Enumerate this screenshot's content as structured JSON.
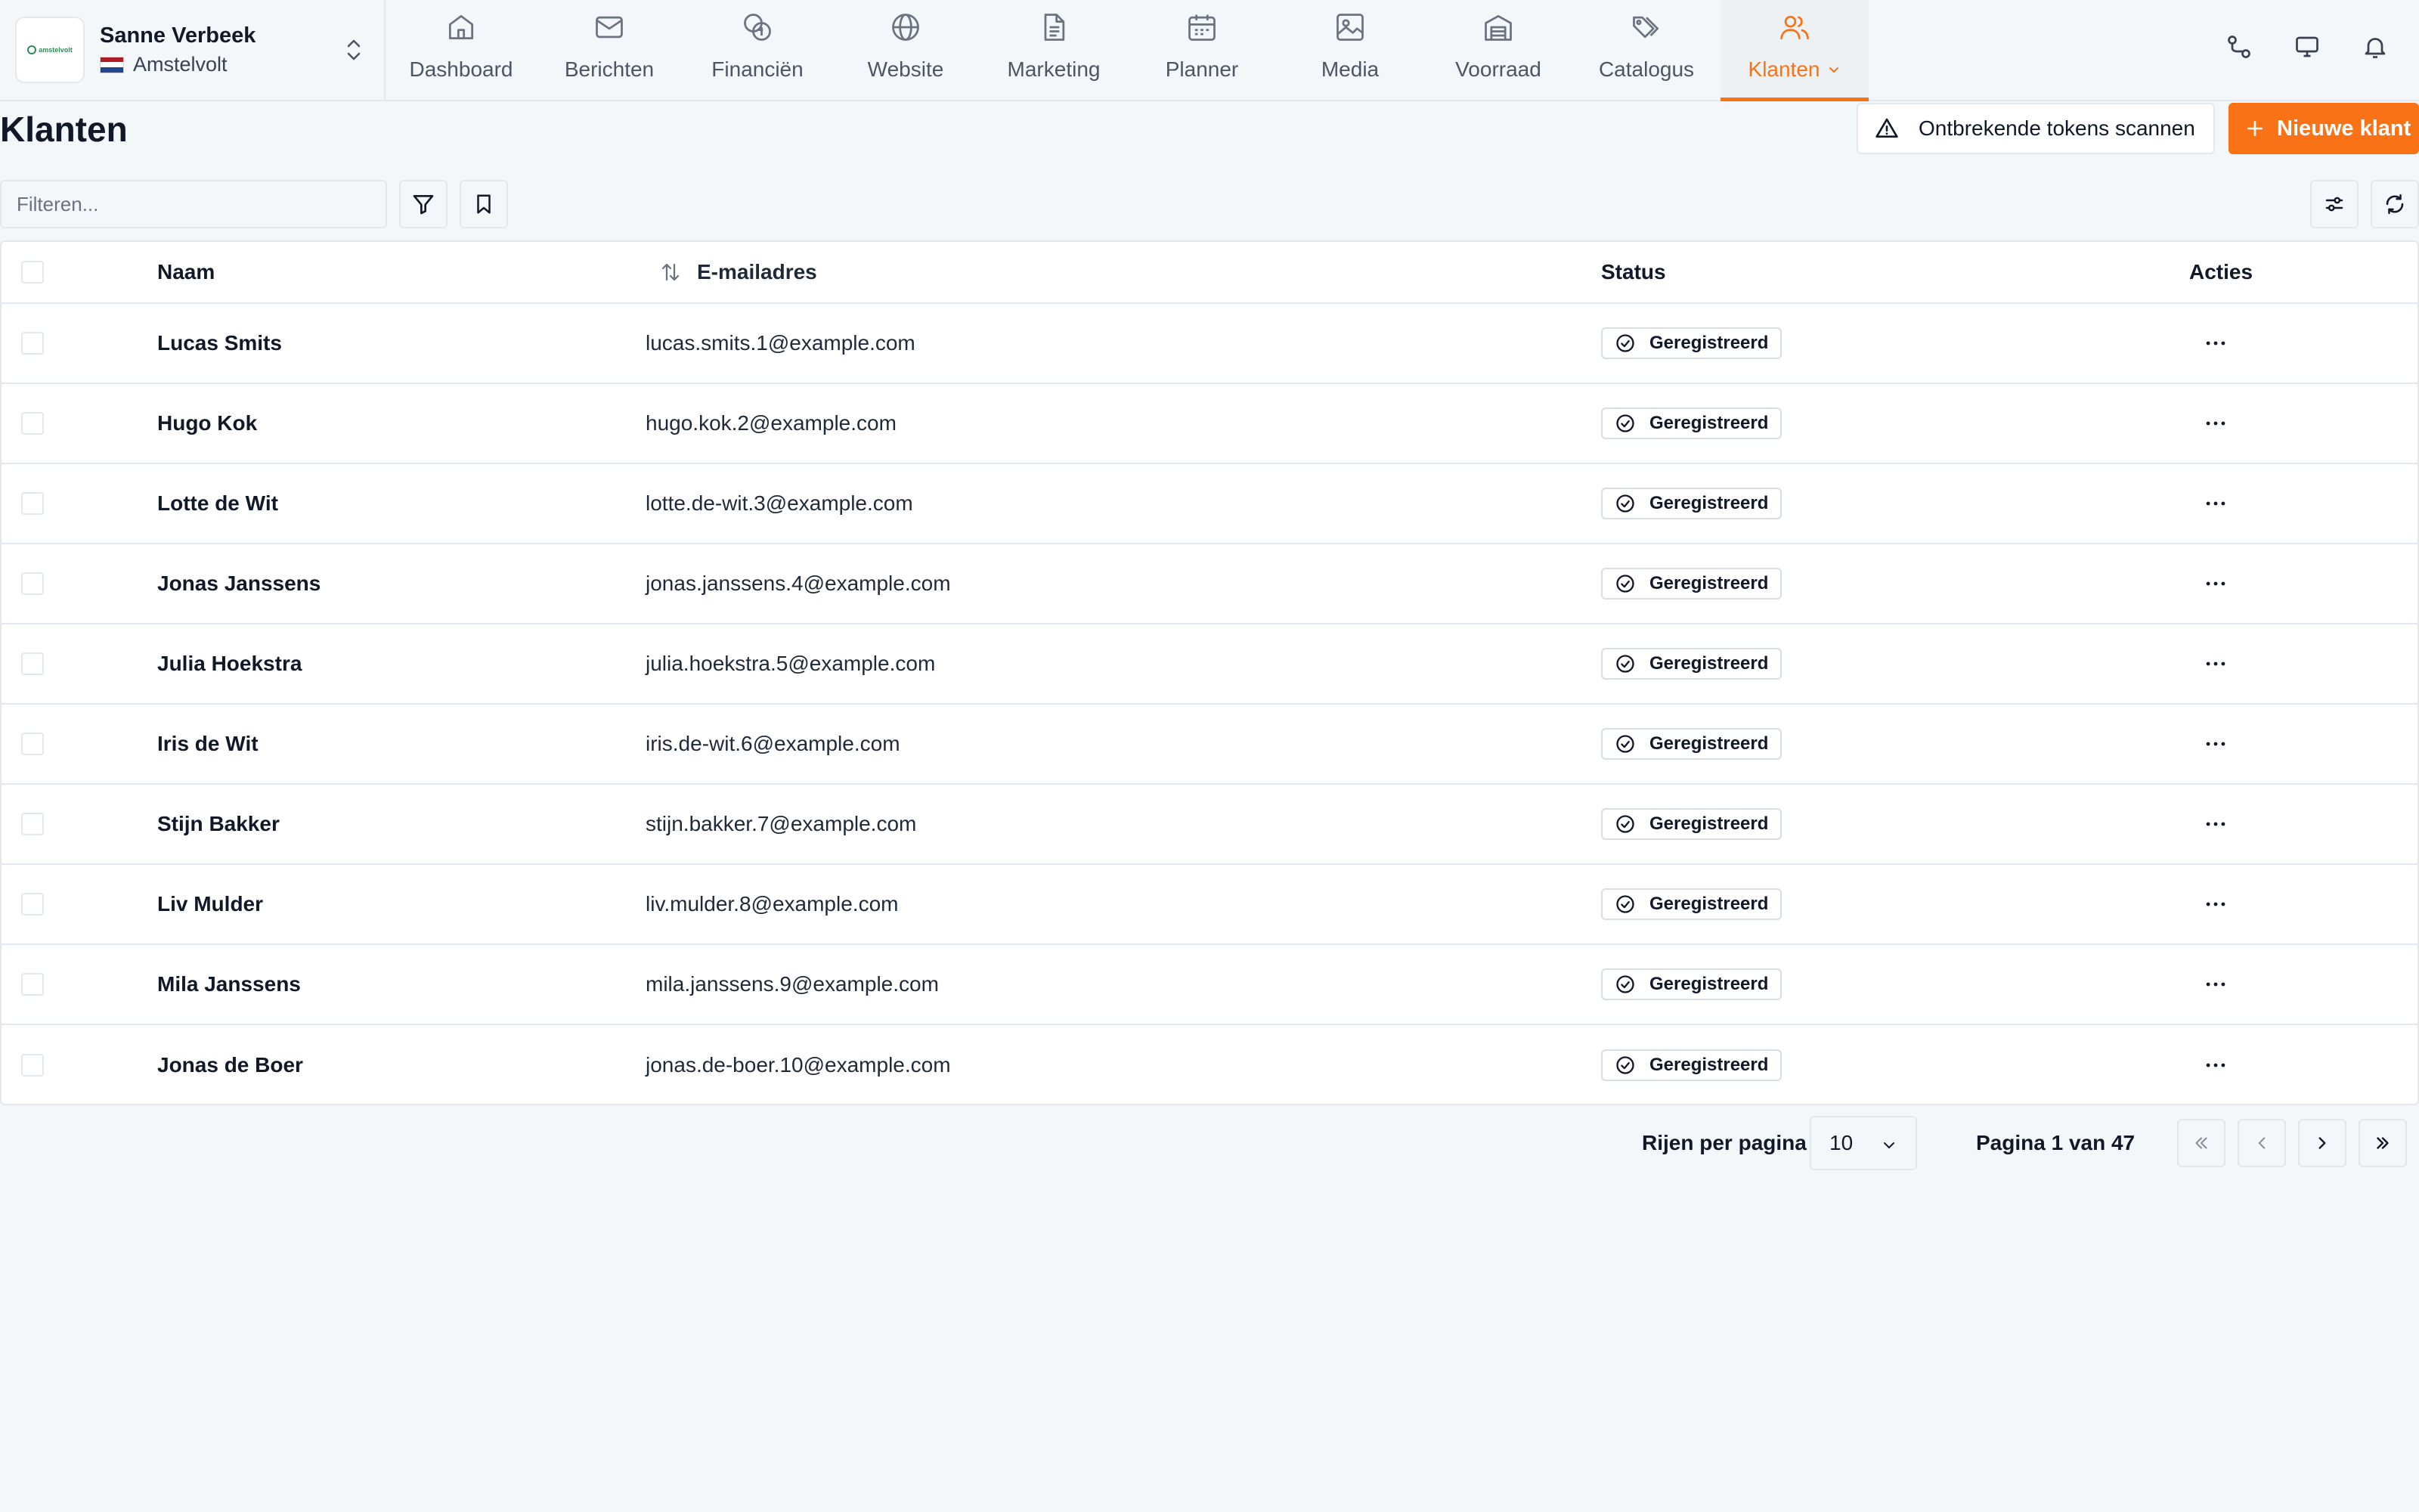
{
  "account": {
    "name": "Sanne Verbeek",
    "location": "Amstelvolt",
    "logo_text": "amstelvolt"
  },
  "nav": {
    "items": [
      {
        "label": "Dashboard",
        "icon": "home-icon"
      },
      {
        "label": "Berichten",
        "icon": "mail-icon"
      },
      {
        "label": "Financiën",
        "icon": "coins-icon"
      },
      {
        "label": "Website",
        "icon": "globe-icon"
      },
      {
        "label": "Marketing",
        "icon": "document-icon"
      },
      {
        "label": "Planner",
        "icon": "calendar-icon"
      },
      {
        "label": "Media",
        "icon": "image-icon"
      },
      {
        "label": "Voorraad",
        "icon": "warehouse-icon"
      },
      {
        "label": "Catalogus",
        "icon": "tags-icon"
      },
      {
        "label": "Klanten",
        "icon": "users-icon"
      }
    ],
    "active": "Klanten"
  },
  "page": {
    "title": "Klanten",
    "scan_button": "Ontbrekende tokens scannen",
    "new_button": "Nieuwe klant"
  },
  "filter": {
    "placeholder": "Filteren..."
  },
  "table": {
    "columns": {
      "name": "Naam",
      "email": "E-mailadres",
      "status": "Status",
      "actions": "Acties"
    },
    "rows": [
      {
        "name": "Lucas Smits",
        "email": "lucas.smits.1@example.com",
        "status": "Geregistreerd"
      },
      {
        "name": "Hugo Kok",
        "email": "hugo.kok.2@example.com",
        "status": "Geregistreerd"
      },
      {
        "name": "Lotte de Wit",
        "email": "lotte.de-wit.3@example.com",
        "status": "Geregistreerd"
      },
      {
        "name": "Jonas Janssens",
        "email": "jonas.janssens.4@example.com",
        "status": "Geregistreerd"
      },
      {
        "name": "Julia Hoekstra",
        "email": "julia.hoekstra.5@example.com",
        "status": "Geregistreerd"
      },
      {
        "name": "Iris de Wit",
        "email": "iris.de-wit.6@example.com",
        "status": "Geregistreerd"
      },
      {
        "name": "Stijn Bakker",
        "email": "stijn.bakker.7@example.com",
        "status": "Geregistreerd"
      },
      {
        "name": "Liv Mulder",
        "email": "liv.mulder.8@example.com",
        "status": "Geregistreerd"
      },
      {
        "name": "Mila Janssens",
        "email": "mila.janssens.9@example.com",
        "status": "Geregistreerd"
      },
      {
        "name": "Jonas de Boer",
        "email": "jonas.de-boer.10@example.com",
        "status": "Geregistreerd"
      }
    ]
  },
  "pagination": {
    "rows_label": "Rijen per pagina",
    "rows_value": "10",
    "page_info": "Pagina 1 van 47"
  },
  "colors": {
    "accent": "#f97316",
    "background": "#f4f7fa",
    "border": "#e3e8ee"
  }
}
